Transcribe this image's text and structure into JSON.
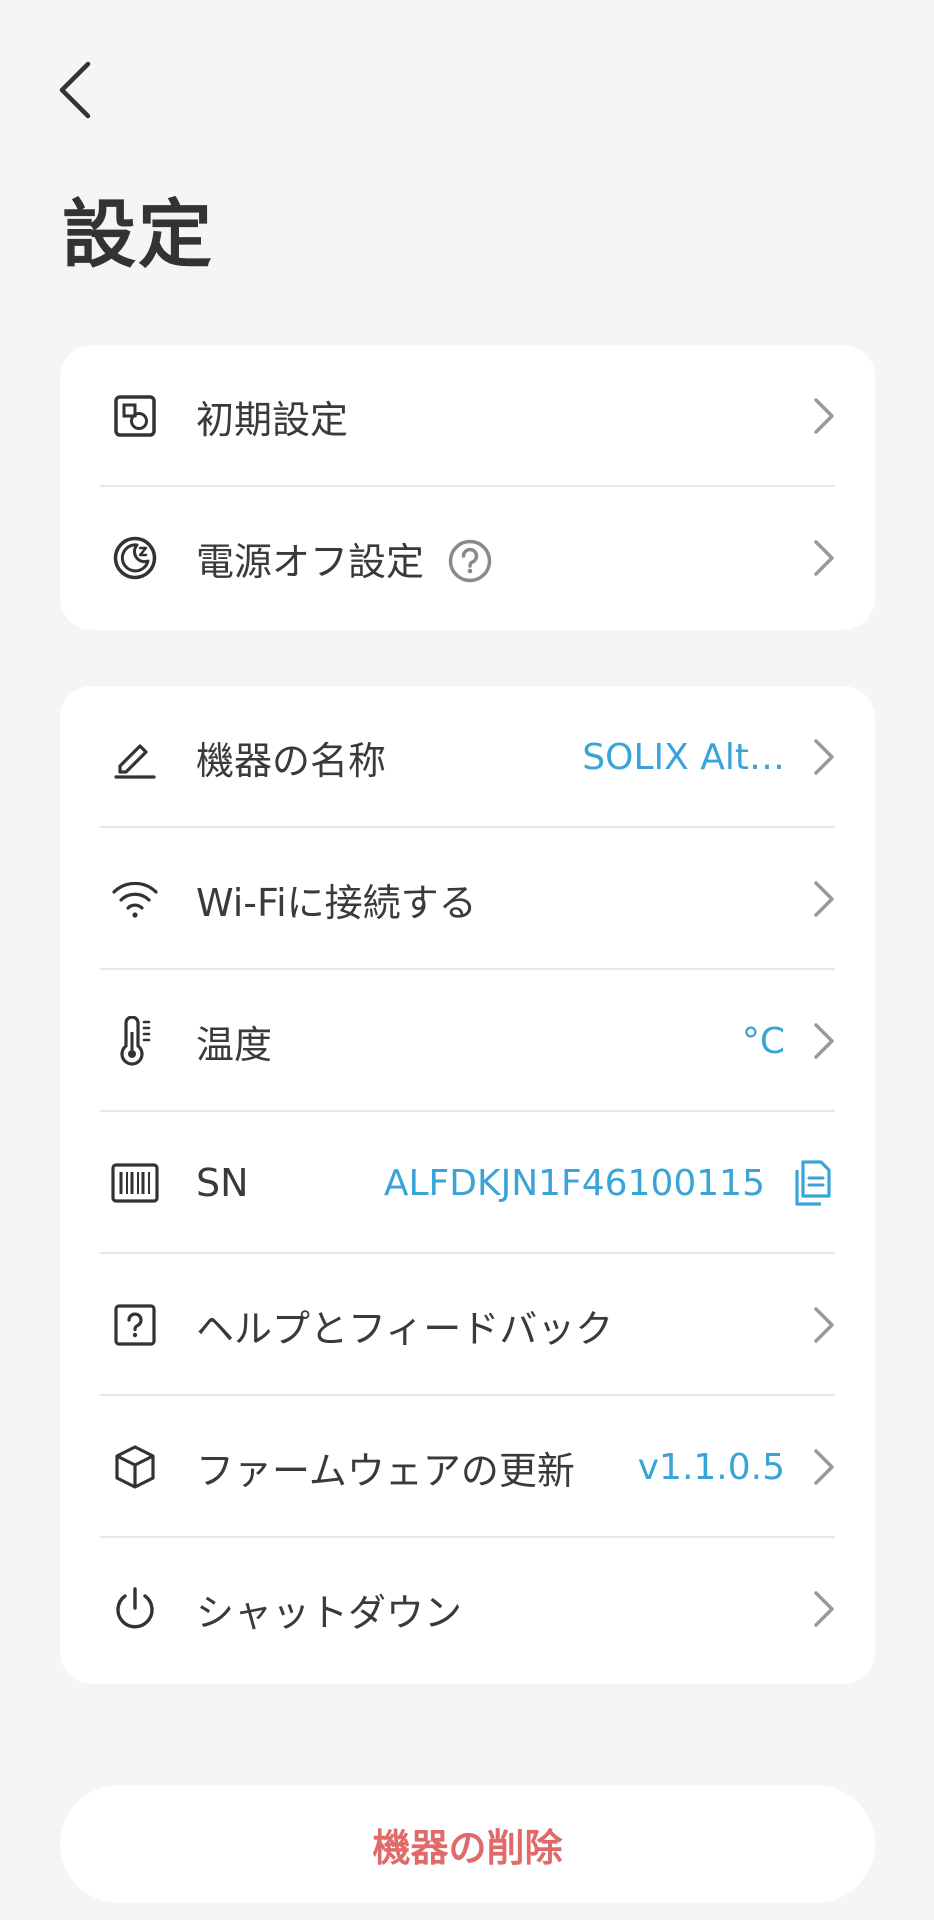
{
  "header": {
    "back_icon": "chevron-left-icon",
    "title": "設定"
  },
  "card1": {
    "items": [
      {
        "icon": "initial-setup-icon",
        "label": "初期設定"
      },
      {
        "icon": "power-off-timer-icon",
        "label": "電源オフ設定",
        "help_icon": "question-circle-icon"
      }
    ]
  },
  "card2": {
    "items": [
      {
        "icon": "pencil-icon",
        "label": "機器の名称",
        "value": "SOLIX Alt…"
      },
      {
        "icon": "wifi-icon",
        "label": "Wi-Fiに接続する"
      },
      {
        "icon": "thermometer-icon",
        "label": "温度",
        "value": "°C"
      },
      {
        "icon": "barcode-icon",
        "label": "SN",
        "value": "ALFDKJN1F46100115",
        "action_icon": "copy-icon"
      },
      {
        "icon": "help-square-icon",
        "label": "ヘルプとフィードバック"
      },
      {
        "icon": "cube-icon",
        "label": "ファームウェアの更新",
        "value": "v1.1.0.5"
      },
      {
        "icon": "power-icon",
        "label": "シャットダウン"
      }
    ]
  },
  "delete": {
    "label": "機器の削除"
  },
  "colors": {
    "accent": "#3aa3d8",
    "danger": "#e06a6a",
    "background": "#f5f5f5",
    "card": "#ffffff",
    "divider": "#e7e7e7"
  }
}
